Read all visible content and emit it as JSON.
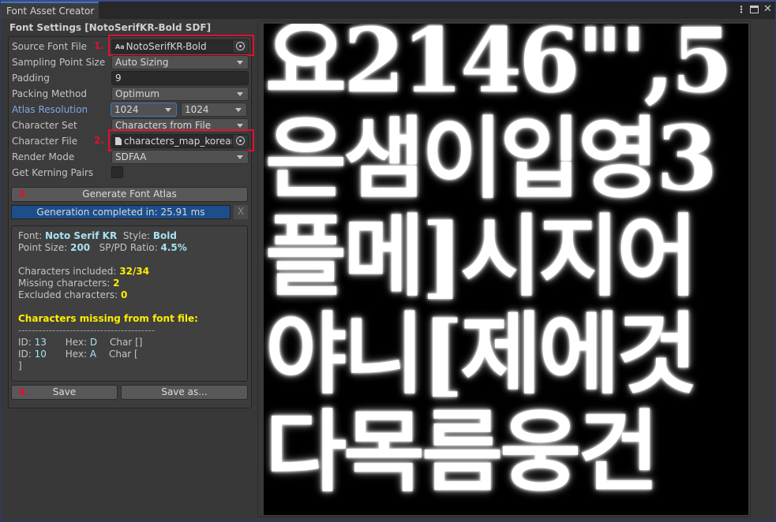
{
  "window": {
    "tab_title": "Font Asset Creator",
    "controls": {
      "menu": "⋮",
      "close": "✕"
    }
  },
  "settings": {
    "section_title": "Font Settings [NotoSerifKR-Bold SDF]",
    "source_font_file": {
      "label": "Source Font File",
      "value": "NotoSerifKR-Bold",
      "icon_text": "Aa",
      "step": "1."
    },
    "sampling_point_size": {
      "label": "Sampling Point Size",
      "value": "Auto Sizing"
    },
    "padding": {
      "label": "Padding",
      "value": "9"
    },
    "packing_method": {
      "label": "Packing Method",
      "value": "Optimum"
    },
    "atlas_resolution": {
      "label": "Atlas Resolution",
      "width": "1024",
      "height": "1024"
    },
    "character_set": {
      "label": "Character Set",
      "value": "Characters from File"
    },
    "character_file": {
      "label": "Character File",
      "value": "characters_map_korean",
      "step": "2."
    },
    "render_mode": {
      "label": "Render Mode",
      "value": "SDFAA"
    },
    "kerning": {
      "label": "Get Kerning Pairs",
      "checked": false
    }
  },
  "actions": {
    "generate": {
      "label": "Generate Font Atlas",
      "step": "3."
    },
    "progress": {
      "text": "Generation completed in: 25.91 ms",
      "close": "X",
      "fraction": 1.0
    },
    "save": {
      "label": "Save",
      "step": "4."
    },
    "save_as": {
      "label": "Save as..."
    }
  },
  "info": {
    "font_label": "Font: ",
    "font_value": "Noto Serif KR",
    "style_label": "Style: ",
    "style_value": "Bold",
    "point_size_label": "Point Size: ",
    "point_size_value": "200",
    "ratio_label": "SP/PD Ratio: ",
    "ratio_value": "4.5%",
    "included_label": "Characters included: ",
    "included_value": "32/34",
    "missing_label": "Missing characters: ",
    "missing_value": "2",
    "excluded_label": "Excluded characters: ",
    "excluded_value": "0",
    "missing_header": "Characters missing from font file:",
    "separator": "----------------------------------------",
    "missing_chars": [
      {
        "id_label": "ID: ",
        "id": "13",
        "hex_label": "Hex: ",
        "hex": "D",
        "char_label": "Char []"
      },
      {
        "id_label": "ID: ",
        "id": "10",
        "hex_label": "Hex: ",
        "hex": "A",
        "char_label": "Char ["
      }
    ],
    "trailing": "]"
  },
  "atlas": {
    "rows": [
      "요2146\"',5",
      "은샘이입영3",
      "플메]시지어",
      "야니[제에것",
      "다목름웅건"
    ]
  },
  "colors": {
    "highlight": "#e0102e",
    "progress": "#1d4e8b",
    "info_value": "#a6e2f2",
    "warning": "#ffee00",
    "focused_label": "#7aa8e6"
  }
}
